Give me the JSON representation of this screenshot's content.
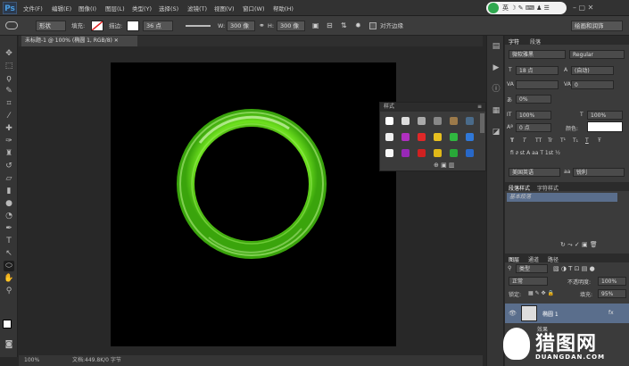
{
  "app": {
    "logo": "Ps"
  },
  "menu": [
    "文件(F)",
    "编辑(E)",
    "图像(I)",
    "图层(L)",
    "类型(Y)",
    "选择(S)",
    "滤镜(T)",
    "视图(V)",
    "窗口(W)",
    "帮助(H)"
  ],
  "options": {
    "shape_mode": "形状",
    "fill_label": "填充:",
    "stroke_label": "描边:",
    "stroke_size": "36 点",
    "w_label": "W:",
    "w_value": "300 像",
    "h_label": "H:",
    "h_value": "300 像",
    "align_edges": "对齐边缘",
    "workspace": "绘画和润饰"
  },
  "document": {
    "tab_title": "未标题-1 @ 100% (椭圆 1, RGB/8)",
    "zoom": "100%",
    "status": "文档:449.8K/0 字节"
  },
  "styles_panel": {
    "title": "样式"
  },
  "character_panel": {
    "tabs": [
      "字符",
      "段落"
    ],
    "font_family": "微软雅黑",
    "font_style": "Regular",
    "font_size": "18 点",
    "leading": "(自动)",
    "tracking": "0",
    "scale_pct": "0%",
    "vertical_scale": "100%",
    "horizontal_scale": "100%",
    "baseline": "0 点",
    "color_label": "颜色:",
    "typo_buttons": [
      "T",
      "T",
      "TT",
      "Tr",
      "T¹",
      "T₁",
      "T",
      "Ŧ"
    ],
    "language": "美国英语",
    "aa_label": "aa",
    "antialias": "锐利"
  },
  "paragraph_styles": {
    "tabs": [
      "段落样式",
      "字符样式"
    ],
    "item": "基本段落"
  },
  "layers_panel": {
    "tabs": [
      "图层",
      "通道",
      "路径"
    ],
    "filter_kind": "类型",
    "blend_mode": "正常",
    "opacity_label": "不透明度:",
    "opacity": "100%",
    "lock_label": "锁定:",
    "fill_label": "填充:",
    "fill": "95%",
    "layer_name": "椭圆 1",
    "effects_label": "效果"
  },
  "watermark": {
    "brand": "猎图网",
    "url": "DUANGDAN.COM"
  },
  "colors": {
    "ring": "#5fd616",
    "ring_dark": "#2f8a07",
    "accent": "#5a6e8c"
  }
}
